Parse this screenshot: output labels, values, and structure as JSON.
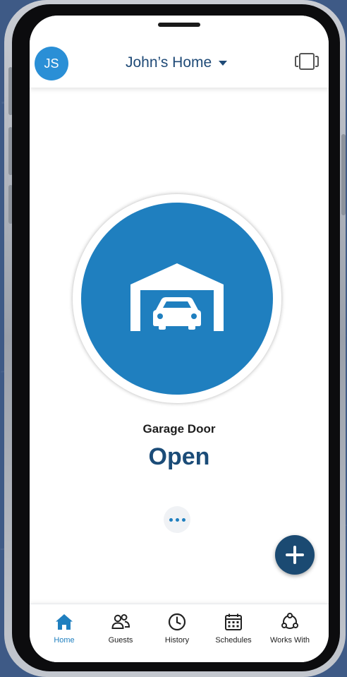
{
  "header": {
    "avatar_initials": "JS",
    "home_name": "John’s Home",
    "caret_icon": "caret-down-icon",
    "devices_icon": "devices-switch-icon"
  },
  "device": {
    "icon": "garage-car-icon",
    "name": "Garage Door",
    "state": "Open"
  },
  "actions": {
    "more_icon": "more-horizontal-icon",
    "add_icon": "plus-icon"
  },
  "tabs": [
    {
      "label": "Home",
      "icon": "home-icon",
      "active": true
    },
    {
      "label": "Guests",
      "icon": "guests-icon",
      "active": false
    },
    {
      "label": "History",
      "icon": "clock-icon",
      "active": false
    },
    {
      "label": "Schedules",
      "icon": "calendar-icon",
      "active": false
    },
    {
      "label": "Works With",
      "icon": "works-with-icon",
      "active": false
    }
  ],
  "colors": {
    "primary_blue": "#1f7fbf",
    "dark_navy": "#1b4a72",
    "avatar_blue": "#2a8fd6",
    "background": "#3e5a86"
  }
}
